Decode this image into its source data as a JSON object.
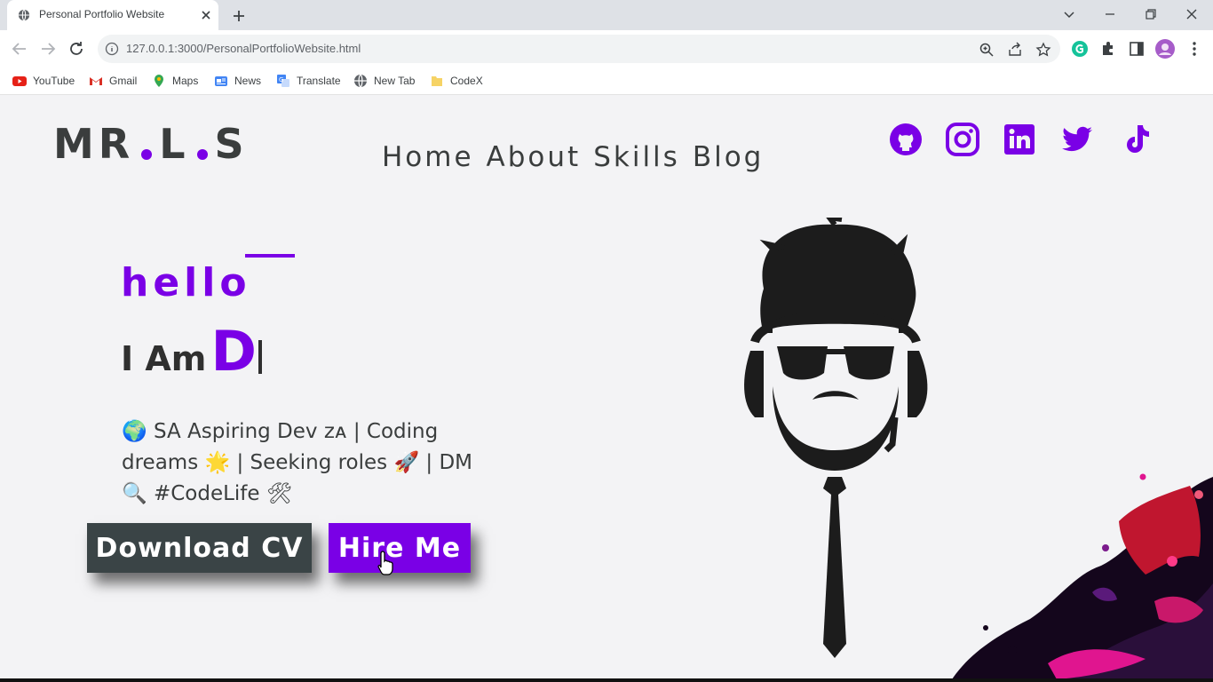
{
  "browser": {
    "tab_title": "Personal Portfolio Website",
    "url": "127.0.0.1:3000/PersonalPortfolioWebsite.html",
    "bookmarks": [
      {
        "label": "YouTube",
        "icon": "youtube-icon"
      },
      {
        "label": "Gmail",
        "icon": "gmail-icon"
      },
      {
        "label": "Maps",
        "icon": "maps-icon"
      },
      {
        "label": "News",
        "icon": "news-icon"
      },
      {
        "label": "Translate",
        "icon": "translate-icon"
      },
      {
        "label": "New Tab",
        "icon": "globe-icon"
      },
      {
        "label": "CodeX",
        "icon": "folder-icon"
      }
    ]
  },
  "site": {
    "logo": {
      "part1": "MR",
      "part2": "L",
      "part3": "S"
    },
    "nav": [
      "Home",
      "About",
      "Skills",
      "Blog"
    ],
    "social": [
      "github-icon",
      "instagram-icon",
      "linkedin-icon",
      "twitter-icon",
      "tiktok-icon"
    ],
    "accent": "#7a00e6"
  },
  "hero": {
    "hello": "hello",
    "iam_prefix": "I Am",
    "typed_name": "D",
    "bio_lines": [
      "🌍 SA Aspiring Dev ᴢᴀ | Coding",
      "dreams 🌟 | Seeking roles 🚀 | DM",
      "🔍 #CodeLife 🛠"
    ],
    "buttons": {
      "download_cv": "Download CV",
      "hire_me": "Hire Me"
    }
  }
}
